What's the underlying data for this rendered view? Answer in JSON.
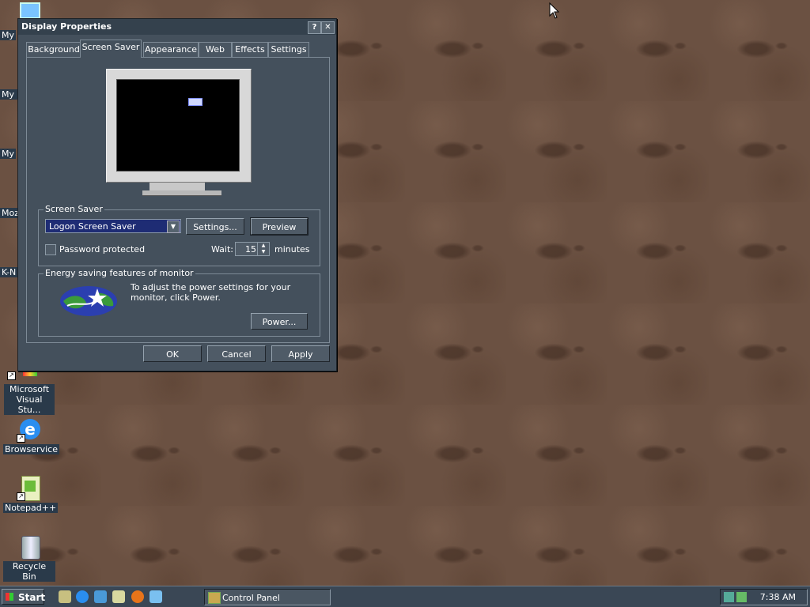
{
  "desktop": {
    "icons": [
      {
        "label": "My",
        "name": "my-computer"
      },
      {
        "label": "My D",
        "name": "my-documents"
      },
      {
        "label": "My",
        "name": "my-network"
      },
      {
        "label": "Moz",
        "name": "mozilla"
      },
      {
        "label": "K-N",
        "name": "k-meleon"
      },
      {
        "label": "Microsoft Visual Stu...",
        "name": "visual-studio"
      },
      {
        "label": "Browservice",
        "name": "browservice"
      },
      {
        "label": "Notepad++",
        "name": "notepad-plus-plus"
      },
      {
        "label": "Recycle Bin",
        "name": "recycle-bin"
      }
    ]
  },
  "dialog": {
    "title": "Display Properties",
    "help_btn": "?",
    "close_btn": "✕",
    "tabs": [
      "Background",
      "Screen Saver",
      "Appearance",
      "Web",
      "Effects",
      "Settings"
    ],
    "active_tab": "Screen Saver",
    "screensaver_group": {
      "title": "Screen Saver",
      "selected": "Logon Screen Saver",
      "settings_btn": "Settings...",
      "preview_btn": "Preview",
      "password_label": "Password protected",
      "password_checked": false,
      "wait_label": "Wait:",
      "wait_value": "15",
      "wait_unit": "minutes"
    },
    "energy_group": {
      "title": "Energy saving features of monitor",
      "text": "To adjust the power settings for your monitor, click Power.",
      "power_btn": "Power..."
    },
    "ok_btn": "OK",
    "cancel_btn": "Cancel",
    "apply_btn": "Apply"
  },
  "taskbar": {
    "start_label": "Start",
    "quick_launch": [
      "show-desktop-icon",
      "ie-icon",
      "outlook-icon",
      "explorer-icon",
      "firefox-icon",
      "send-icon"
    ],
    "task_label": "Control Panel",
    "clock": "7:38 AM"
  },
  "colors": {
    "dialog_bg": "#44505c",
    "selection": "#1e2c74",
    "desktop_bg": "#6b5142"
  }
}
